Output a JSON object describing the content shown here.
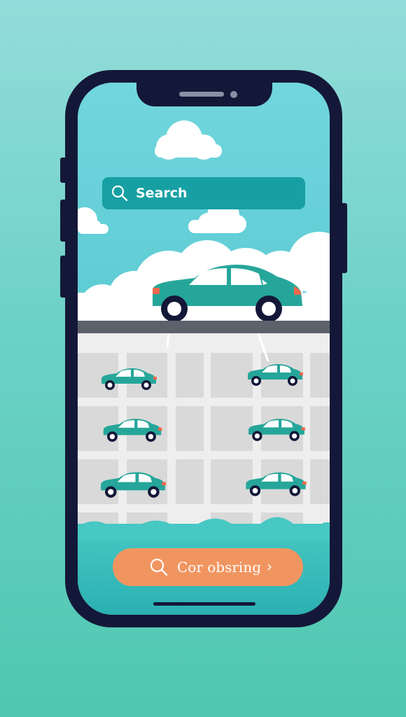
{
  "search": {
    "label": "Search",
    "icon": "search-icon"
  },
  "cta": {
    "label": "Cor obsring",
    "icon": "search-icon",
    "chevron": "›"
  },
  "colors": {
    "teal": "#17a0a3",
    "car": "#26a69a",
    "orange": "#f19560",
    "phone_frame": "#141838",
    "taillight": "#f2674c"
  },
  "map": {
    "car_count": 6
  }
}
